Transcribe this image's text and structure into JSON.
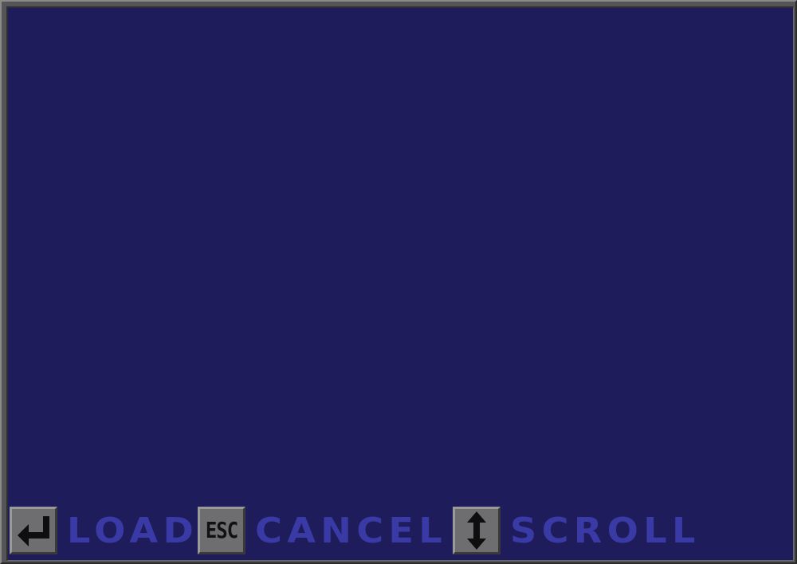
{
  "hints": {
    "load": {
      "key_icon": "enter-key-icon",
      "label": "LOAD"
    },
    "cancel": {
      "key_text": "ESC",
      "label": "CANCEL"
    },
    "scroll": {
      "key_icon": "up-down-arrow-icon",
      "label": "SCROLL"
    }
  },
  "colors": {
    "panel_background": "#1e1c5a",
    "frame": "#555558",
    "label_text": "#3a3aa6",
    "key_face": "#6e6e70"
  }
}
